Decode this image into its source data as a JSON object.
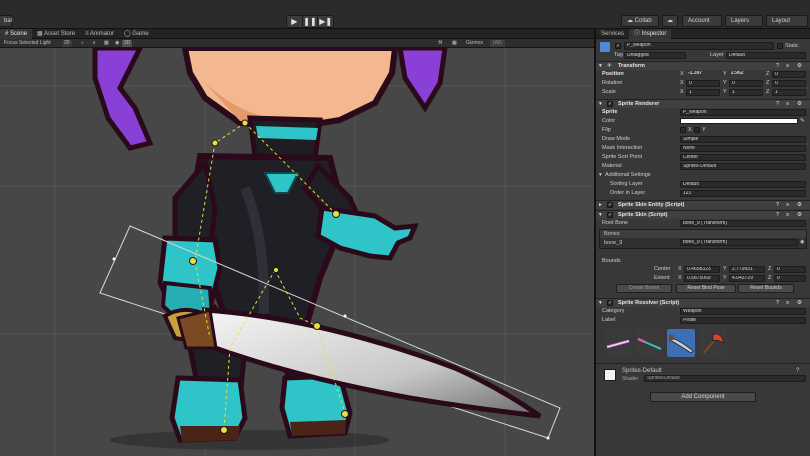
{
  "toolbar": {
    "left_label": "bal",
    "collab_label": "Collab",
    "account_label": "Account",
    "layers_label": "Layers",
    "layout_label": "Layout"
  },
  "scene_tabs": [
    {
      "label": "Scene",
      "active": true
    },
    {
      "label": "Asset Store",
      "active": false
    },
    {
      "label": "Animator",
      "active": false
    },
    {
      "label": "Game",
      "active": false
    }
  ],
  "right_tabs": [
    {
      "label": "Services",
      "active": false
    },
    {
      "label": "Inspector",
      "active": true
    }
  ],
  "scene_toolbar": {
    "focus_label": "Focus Selected Light",
    "focus_value": "20",
    "mode_2d": "2D",
    "gizmos_label": "Gizmos",
    "search_placeholder": "(All)"
  },
  "inspector": {
    "object_name": "P_weapon",
    "static_label": "Static",
    "tag_label": "Tag",
    "tag_value": "Untagged",
    "layer_label": "Layer",
    "layer_value": "Default",
    "transform": {
      "title": "Transform",
      "position_label": "Position",
      "rotation_label": "Rotation",
      "scale_label": "Scale",
      "position": {
        "x": "-1.397",
        "y": "2.962",
        "z": "0"
      },
      "rotation": {
        "x": "0",
        "y": "0",
        "z": "0"
      },
      "scale": {
        "x": "1",
        "y": "1",
        "z": "1"
      }
    },
    "sprite_renderer": {
      "title": "Sprite Renderer",
      "sprite_label": "Sprite",
      "sprite_value": "P_weapon",
      "color_label": "Color",
      "flip_label": "Flip",
      "flip_x": "X",
      "flip_y": "Y",
      "draw_mode_label": "Draw Mode",
      "draw_mode_value": "Simple",
      "mask_label": "Mask Interaction",
      "mask_value": "None",
      "sort_point_label": "Sprite Sort Point",
      "sort_point_value": "Center",
      "material_label": "Material",
      "material_value": "Sprites-Default",
      "additional_label": "Additional Settings",
      "sorting_layer_label": "Sorting Layer",
      "sorting_layer_value": "Default",
      "order_label": "Order in Layer",
      "order_value": "121"
    },
    "sprite_skin_entity": {
      "title": "Sprite Skin Entity (Script)"
    },
    "sprite_skin": {
      "title": "Sprite Skin (Script)",
      "root_bone_label": "Root Bone",
      "root_bone_value": "bone_9 (Transform)",
      "bones_label": "Bones",
      "bone_row_label": "bone_9",
      "bone_row_value": "bone_9 (Transform)",
      "bounds_label": "Bounds",
      "center_label": "Center",
      "center": {
        "x": "0.4658323",
        "y": "2.779931",
        "z": "0"
      },
      "extent_label": "Extent",
      "extent": {
        "x": "0.5875069",
        "y": "4.043729",
        "z": "0"
      },
      "create_bones_label": "Create Bones",
      "reset_bind_label": "Reset Bind Pose",
      "reset_bounds_label": "Reset Bounds"
    },
    "sprite_resolver": {
      "title": "Sprite Resolver (Script)",
      "category_label": "Category",
      "category_value": "Weapon",
      "label_label": "Label",
      "label_value": "Pirate"
    },
    "material_block": {
      "name": "Sprites-Default",
      "shader_label": "Shader",
      "shader_value": "Sprites/Default"
    },
    "add_component_label": "Add Component",
    "axes": {
      "x": "X",
      "y": "Y",
      "z": "Z"
    }
  },
  "colors": {
    "accent_blue": "#3d6fb6",
    "teal": "#2ec4c8",
    "purple_hair": "#8a3fd6",
    "bone_yellow": "#e6e040"
  }
}
